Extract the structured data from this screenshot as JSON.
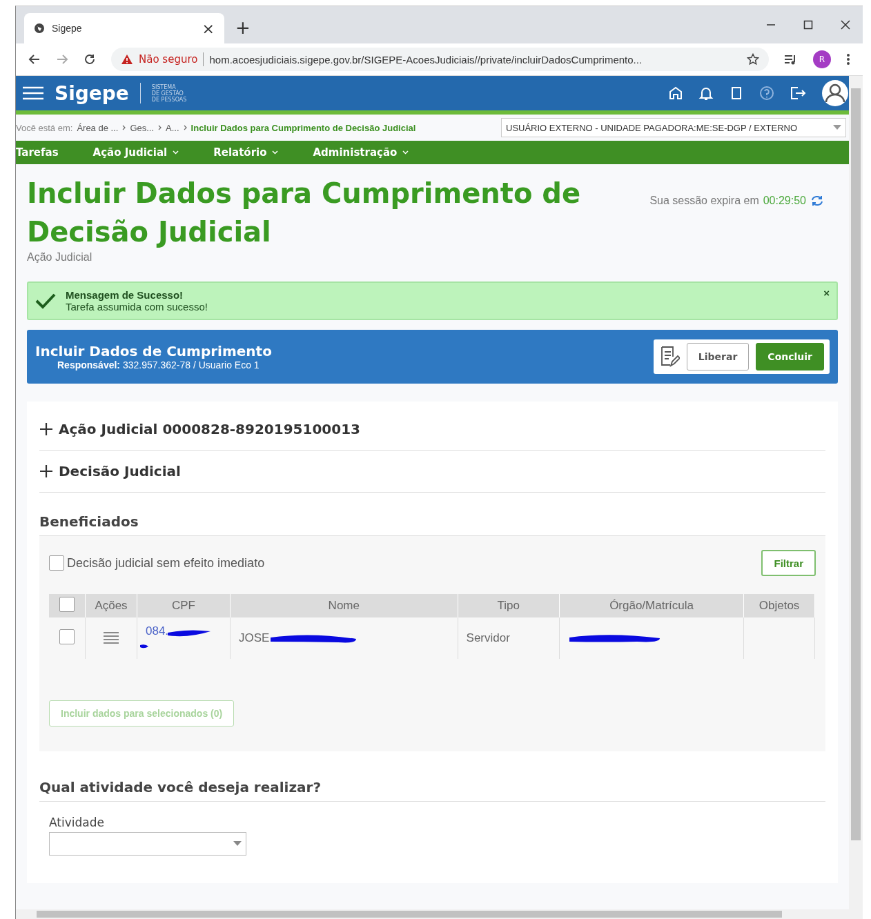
{
  "browser": {
    "tab_title": "Sigepe",
    "close_tab": "×",
    "new_tab": "+",
    "security": "Não seguro",
    "url": "hom.acoesjudiciais.sigepe.gov.br/SIGEPE-AcoesJudiciais//private/incluirDadosCumprimento...",
    "profile": "R"
  },
  "header": {
    "logo": "Sigepe",
    "logo_sub": [
      "SISTEMA",
      "DE GESTÃO",
      "DE PESSOAS"
    ]
  },
  "breadcrumb": {
    "prefix": "Você está em:",
    "items": [
      {
        "label": "Área de ...",
        "current": false
      },
      {
        "label": "Ges...",
        "current": false
      },
      {
        "label": "A...",
        "current": false
      },
      {
        "label": "Incluir Dados para Cumprimento de Decisão Judicial",
        "current": true
      }
    ],
    "profile_select": "USUÁRIO EXTERNO - UNIDADE PAGADORA:ME:SE-DGP / EXTERNO"
  },
  "menu": [
    {
      "label": "Tarefas",
      "dropdown": false
    },
    {
      "label": "Ação Judicial",
      "dropdown": true
    },
    {
      "label": "Relatório",
      "dropdown": true
    },
    {
      "label": "Administração",
      "dropdown": true
    }
  ],
  "page": {
    "title": "Incluir Dados para Cumprimento de Decisão Judicial",
    "subtitle": "Ação Judicial",
    "session_text": "Sua sessão expira em",
    "session_time": "00:29:50"
  },
  "alert": {
    "title": "Mensagem de Sucesso!",
    "message": "Tarefa assumida com sucesso!",
    "close": "×"
  },
  "task": {
    "title": "Incluir Dados de Cumprimento",
    "responsible_label": "Responsável:",
    "responsible": "332.957.362-78 / Usuario Eco 1",
    "buttons": [
      "Liberar",
      "Concluir"
    ]
  },
  "sections": [
    {
      "label": "Ação Judicial 0000828-8920195100013",
      "expanded": false
    },
    {
      "label": "Decisão Judicial",
      "expanded": false
    }
  ],
  "beneficiarios": {
    "title": "Beneficiados",
    "filter_checkbox": {
      "label": "Decisão judicial sem efeito imediato",
      "checked": false
    },
    "filter_button": "Filtrar",
    "all_selected": false,
    "columns": [
      "Ações",
      "CPF",
      "Nome",
      "Tipo",
      "Órgão/Matrícula",
      "Objetos"
    ],
    "rows": [
      {
        "selected": false,
        "cpf": "084.",
        "nome": "JOSE",
        "tipo": "Servidor"
      }
    ],
    "action_button": "Incluir dados para selecionados (0)"
  },
  "atividade": {
    "question": "Qual atividade você deseja realizar?",
    "label": "Atividade"
  }
}
